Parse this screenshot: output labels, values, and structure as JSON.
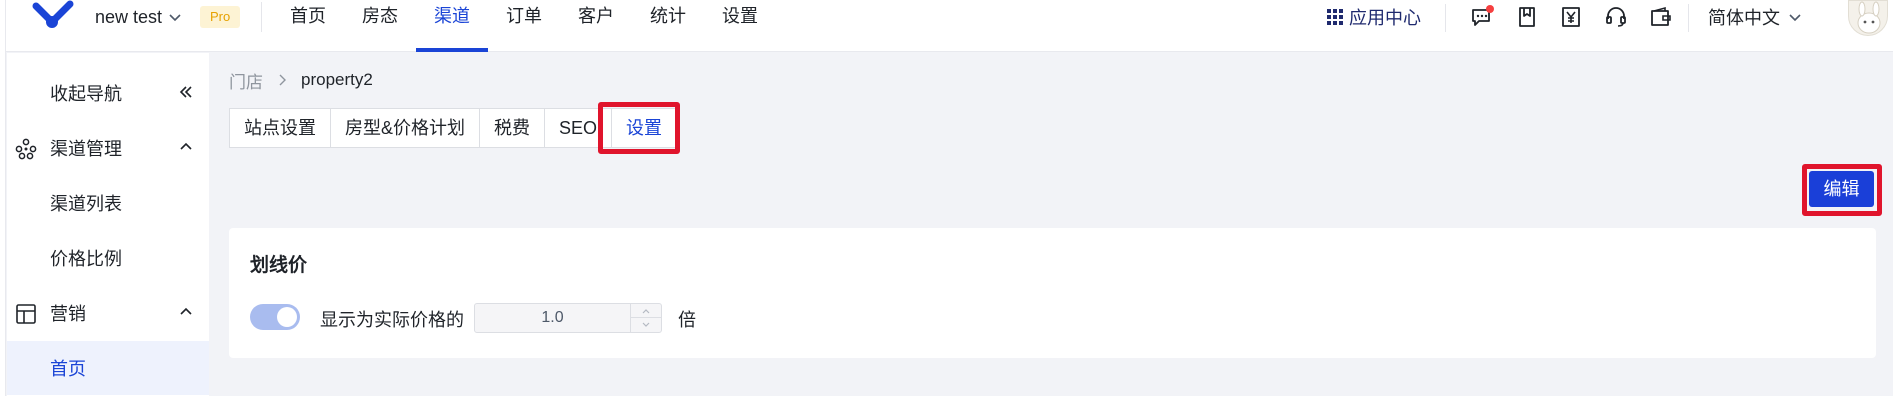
{
  "header": {
    "account_name": "new test",
    "plan_badge": "Pro",
    "nav": [
      {
        "label": "首页"
      },
      {
        "label": "房态"
      },
      {
        "label": "渠道",
        "active": true
      },
      {
        "label": "订单"
      },
      {
        "label": "客户"
      },
      {
        "label": "统计"
      },
      {
        "label": "设置"
      }
    ],
    "app_center_label": "应用中心",
    "language_label": "简体中文",
    "accent_color": "#1a44d6",
    "notification_dot_color": "#f53f3f",
    "tool_icons": [
      "message-icon",
      "bookmark-icon",
      "payment-icon",
      "headset-icon",
      "wallet-icon"
    ]
  },
  "sidebar": {
    "collapse_label": "收起导航",
    "groups": [
      {
        "label": "渠道管理",
        "icon": "channel-icon",
        "children": [
          "渠道列表",
          "价格比例"
        ]
      },
      {
        "label": "营销",
        "icon": "marketing-icon",
        "children": [
          "首页"
        ]
      }
    ],
    "active_item": "首页"
  },
  "breadcrumb": {
    "home": "门店",
    "current": "property2"
  },
  "tabs": [
    {
      "label": "站点设置"
    },
    {
      "label": "房型&价格计划"
    },
    {
      "label": "税费"
    },
    {
      "label": "SEO"
    },
    {
      "label": "设置",
      "active": true
    }
  ],
  "edit_button_label": "编辑",
  "highlight_color": "#e0142c",
  "card": {
    "title": "划线价",
    "toggle_on": true,
    "toggle_label": "显示为实际价格的",
    "multiplier_value": "1.0",
    "suffix": "倍"
  }
}
